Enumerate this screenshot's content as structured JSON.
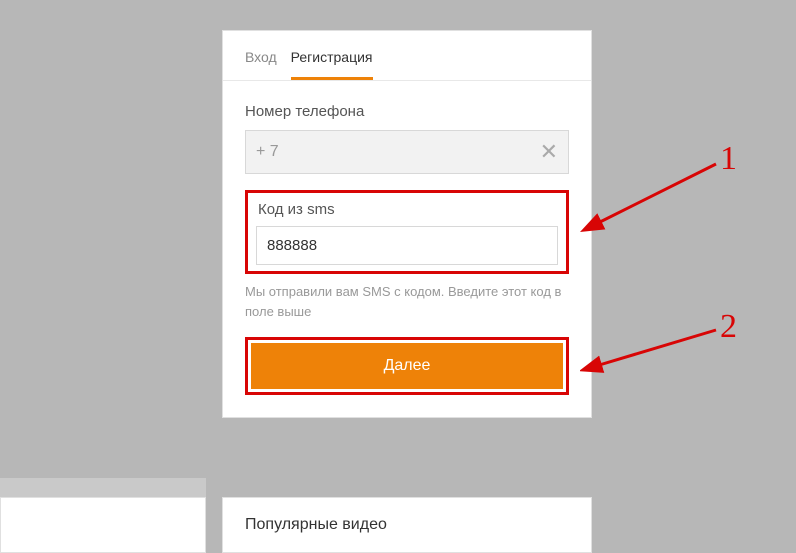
{
  "tabs": {
    "login": "Вход",
    "register": "Регистрация"
  },
  "phone": {
    "label": "Номер телефона",
    "prefix": "+ 7"
  },
  "sms": {
    "label": "Код из sms",
    "value": "888888"
  },
  "helper": "Мы отправили вам SMS с кодом. Введите этот код в поле выше",
  "button": {
    "next": "Далее"
  },
  "annotations": {
    "one": "1",
    "two": "2"
  },
  "popular": {
    "title": "Популярные видео"
  }
}
